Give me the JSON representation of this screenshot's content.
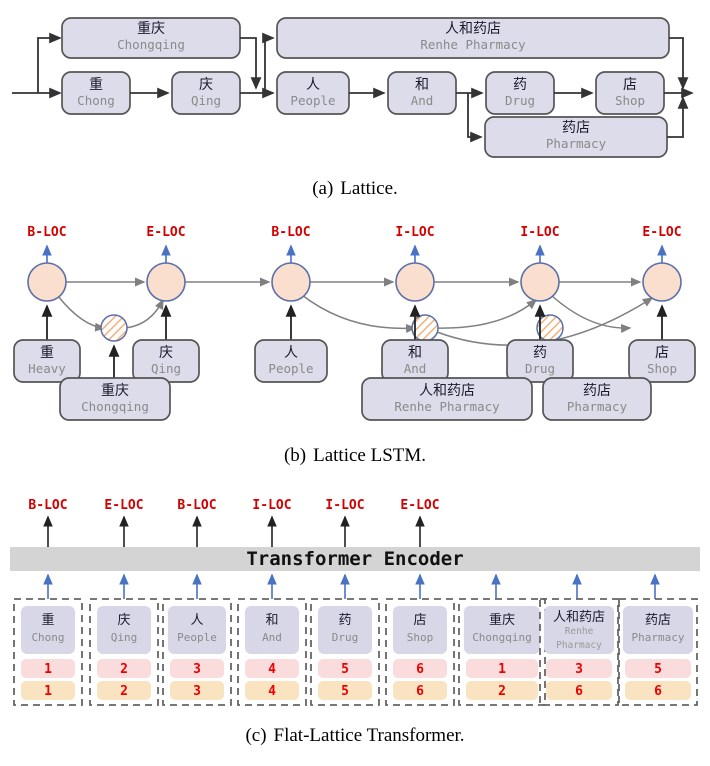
{
  "figure": {
    "panels": [
      {
        "id": "a",
        "caption_index": "(a)",
        "caption_text": "Lattice.",
        "char_nodes": [
          {
            "cn": "重",
            "en": "Chong"
          },
          {
            "cn": "庆",
            "en": "Qing"
          },
          {
            "cn": "人",
            "en": "People"
          },
          {
            "cn": "和",
            "en": "And"
          },
          {
            "cn": "药",
            "en": "Drug"
          },
          {
            "cn": "店",
            "en": "Shop"
          }
        ],
        "word_nodes": [
          {
            "cn": "重庆",
            "en": "Chongqing"
          },
          {
            "cn": "人和药店",
            "en": "Renhe Pharmacy"
          },
          {
            "cn": "药店",
            "en": "Pharmacy"
          }
        ]
      },
      {
        "id": "b",
        "caption_index": "(b)",
        "caption_text": "Lattice LSTM.",
        "tags": [
          "B-LOC",
          "E-LOC",
          "B-LOC",
          "I-LOC",
          "I-LOC",
          "E-LOC"
        ],
        "char_nodes": [
          {
            "cn": "重",
            "en": "Heavy"
          },
          {
            "cn": "庆",
            "en": "Qing"
          },
          {
            "cn": "人",
            "en": "People"
          },
          {
            "cn": "和",
            "en": "And"
          },
          {
            "cn": "药",
            "en": "Drug"
          },
          {
            "cn": "店",
            "en": "Shop"
          }
        ],
        "word_nodes": [
          {
            "cn": "重庆",
            "en": "Chongqing"
          },
          {
            "cn": "人和药店",
            "en": "Renhe Pharmacy"
          },
          {
            "cn": "药店",
            "en": "Pharmacy"
          }
        ]
      },
      {
        "id": "c",
        "caption_index": "(c)",
        "caption_text": "Flat-Lattice Transformer.",
        "encoder_label": "Transformer Encoder",
        "tags": [
          "B-LOC",
          "E-LOC",
          "B-LOC",
          "I-LOC",
          "I-LOC",
          "E-LOC"
        ],
        "tokens": [
          {
            "cn": "重",
            "en": "Chong",
            "head": "1",
            "tail": "1"
          },
          {
            "cn": "庆",
            "en": "Qing",
            "head": "2",
            "tail": "2"
          },
          {
            "cn": "人",
            "en": "People",
            "head": "3",
            "tail": "3"
          },
          {
            "cn": "和",
            "en": "And",
            "head": "4",
            "tail": "4"
          },
          {
            "cn": "药",
            "en": "Drug",
            "head": "5",
            "tail": "5"
          },
          {
            "cn": "店",
            "en": "Shop",
            "head": "6",
            "tail": "6"
          },
          {
            "cn": "重庆",
            "en": "Chongqing",
            "head": "1",
            "tail": "2"
          },
          {
            "cn": "人和药店",
            "en": "Renhe Pharmacy",
            "head": "3",
            "tail": "6"
          },
          {
            "cn": "药店",
            "en": "Pharmacy",
            "head": "5",
            "tail": "6"
          }
        ]
      }
    ]
  },
  "colors": {
    "box_fill": "#dcdcea",
    "box_stroke": "#555555",
    "cell_fill": "#d7d7e8",
    "head_fill": "#fadcdc",
    "tail_fill": "#fae3c0",
    "encoder_fill": "#d4d4d4",
    "cell_node_fill": "#fadfce",
    "cell_node_stroke": "#5b6fa8",
    "tag_red": "#d40000",
    "number_red": "#ee0000",
    "arrow_blue": "#4a72c4",
    "arrow_dark": "#333333",
    "arrow_gray": "#808080",
    "dash_stroke": "#666666"
  }
}
